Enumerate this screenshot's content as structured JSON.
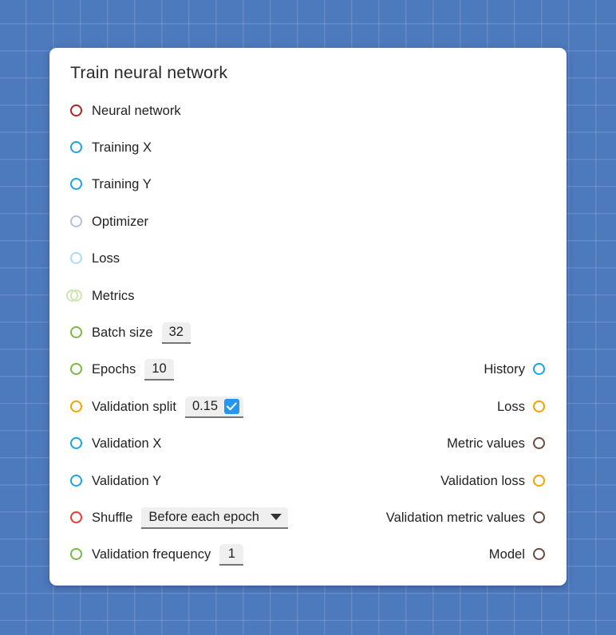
{
  "node": {
    "title": "Train neural network",
    "card_color": "#ffffff",
    "canvas_color": "#4d79bd"
  },
  "inputs": [
    {
      "label": "Neural network",
      "color": "#b02222",
      "shape": "single",
      "faded": false,
      "widget": null
    },
    {
      "label": "Training X",
      "color": "#1ba3e8",
      "shape": "single",
      "faded": false,
      "widget": null
    },
    {
      "label": "Training Y",
      "color": "#1ba3e8",
      "shape": "single",
      "faded": false,
      "widget": null
    },
    {
      "label": "Optimizer",
      "color": "#b9bce0",
      "shape": "single",
      "faded": true,
      "widget": null
    },
    {
      "label": "Loss",
      "color": "#abdcf3",
      "shape": "single",
      "faded": true,
      "widget": null
    },
    {
      "label": "Metrics",
      "color": "#cfe5b4",
      "shape": "list",
      "faded": true,
      "widget": null
    },
    {
      "label": "Batch size",
      "color": "#76bb42",
      "shape": "single",
      "faded": false,
      "widget": {
        "type": "number",
        "value": "32"
      }
    },
    {
      "label": "Epochs",
      "color": "#76bb42",
      "shape": "single",
      "faded": false,
      "widget": {
        "type": "number",
        "value": "10"
      }
    },
    {
      "label": "Validation split",
      "color": "#f5a200",
      "shape": "single",
      "faded": false,
      "widget": {
        "type": "number-check",
        "value": "0.15",
        "checked": true,
        "check_color": "#2196f3"
      }
    },
    {
      "label": "Validation X",
      "color": "#1ba3e8",
      "shape": "single",
      "faded": false,
      "widget": null
    },
    {
      "label": "Validation Y",
      "color": "#1ba3e8",
      "shape": "single",
      "faded": false,
      "widget": null
    },
    {
      "label": "Shuffle",
      "color": "#f0392b",
      "shape": "single",
      "faded": false,
      "widget": {
        "type": "select",
        "value": "Before each epoch"
      }
    },
    {
      "label": "Validation frequency",
      "color": "#76bb42",
      "shape": "single",
      "faded": false,
      "widget": {
        "type": "number",
        "value": "1"
      }
    }
  ],
  "outputs": [
    {
      "row": 7,
      "label": "History",
      "color": "#1ba3e8"
    },
    {
      "row": 8,
      "label": "Loss",
      "color": "#f5a200"
    },
    {
      "row": 9,
      "label": "Metric values",
      "color": "#6b4a40"
    },
    {
      "row": 10,
      "label": "Validation loss",
      "color": "#f5a200"
    },
    {
      "row": 11,
      "label": "Validation metric values",
      "color": "#6b4a40"
    },
    {
      "row": 12,
      "label": "Model",
      "color": "#6b4a40"
    }
  ]
}
